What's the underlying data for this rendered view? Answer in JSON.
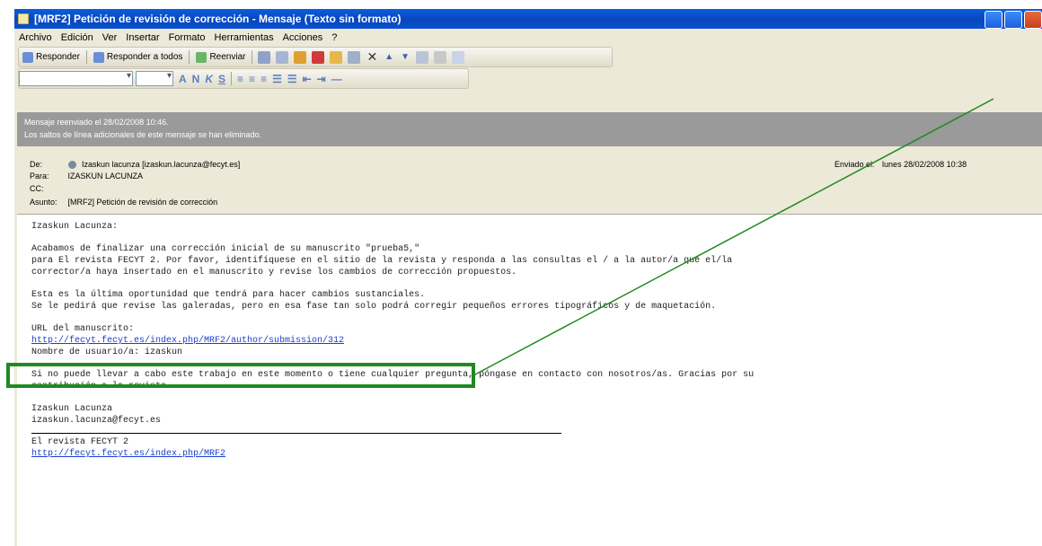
{
  "window": {
    "title": "[MRF2] Petición de revisión de corrección - Mensaje (Texto sin formato)"
  },
  "menubar": {
    "items": [
      "Archivo",
      "Edición",
      "Ver",
      "Insertar",
      "Formato",
      "Herramientas",
      "Acciones",
      "?"
    ]
  },
  "toolbar": {
    "reply": "Responder",
    "reply_all": "Responder a todos",
    "forward": "Reenviar"
  },
  "infobar": {
    "line1": "Mensaje reenviado el 28/02/2008 10:46.",
    "line2": "Los saltos de línea adicionales de este mensaje se han eliminado."
  },
  "header": {
    "from_label": "De:",
    "from_value": "Izaskun lacunza [izaskun.lacunza@fecyt.es]",
    "to_label": "Para:",
    "to_value": "IZASKUN LACUNZA",
    "cc_label": "CC:",
    "subject_label": "Asunto:",
    "subject_value": "[MRF2] Petición de revisión de corrección",
    "sent_label": "Enviado el:",
    "sent_value": "lunes 28/02/2008 10:38"
  },
  "body": {
    "greeting": "Izaskun Lacunza:",
    "p1_line1": "Acabamos de finalizar una corrección inicial de su manuscrito \"prueba5,\"",
    "p1_line2": "para El revista FECYT 2. Por favor, identifíquese en el sitio de la revista y responda a las consultas el / a la autor/a que el/la",
    "p1_line3": "corrector/a haya insertado en el manuscrito y revise los cambios de corrección propuestos.",
    "p2_line1": "Esta es la última oportunidad que tendrá para hacer cambios sustanciales.",
    "p2_line2": "Se le pedirá que revise las galeradas, pero en esa fase tan solo podrá corregir pequeños errores tipográficos y de maquetación.",
    "url_label": "URL del manuscrito:",
    "url": "http://fecyt.fecyt.es/index.php/MRF2/author/submission/312",
    "username_line": "Nombre de usuario/a: izaskun",
    "p3_line1": "Si no puede llevar a cabo este trabajo en este momento o tiene cualquier pregunta, póngase en contacto con nosotros/as. Gracias por su",
    "p3_line2": "contribución a la revista.",
    "sig_name": "Izaskun Lacunza",
    "sig_email": "izaskun.lacunza@fecyt.es",
    "footer_name": "El revista FECYT 2",
    "footer_url": "http://fecyt.fecyt.es/index.php/MRF2"
  },
  "colors": {
    "highlight_box": "#1f8a1f",
    "arrow": "#1f8a1f",
    "title_bar": "#0a52d4",
    "link": "#1a3fd0"
  }
}
